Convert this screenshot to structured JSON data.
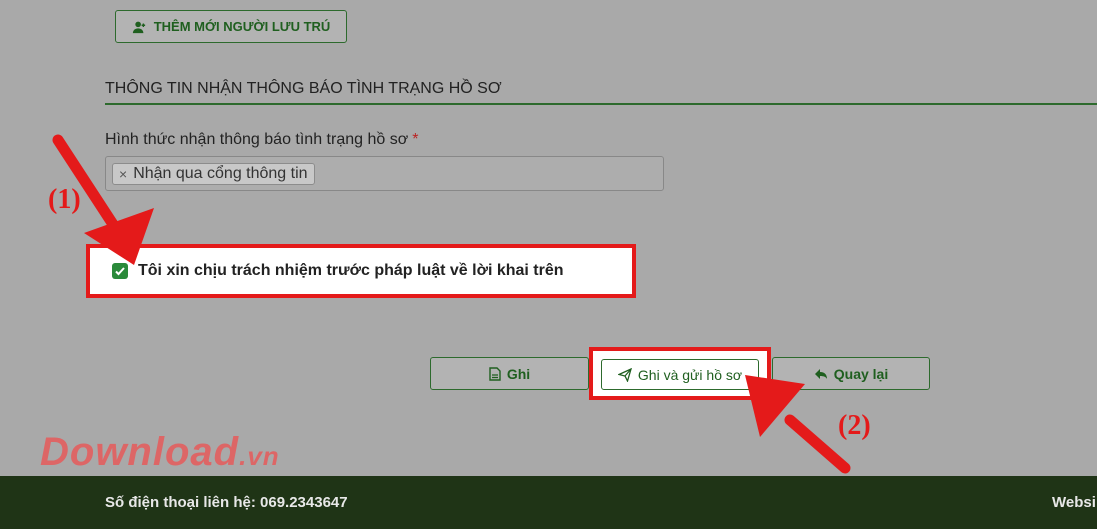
{
  "toolbar": {
    "add_resident_label": "THÊM MỚI NGƯỜI LƯU TRÚ"
  },
  "section": {
    "title": "THÔNG TIN NHẬN THÔNG BÁO TÌNH TRẠNG HỒ SƠ"
  },
  "notify_field": {
    "label": "Hình thức nhận thông báo tình trạng hồ sơ",
    "required_mark": "*",
    "selected_tag": "Nhận qua cổng thông tin",
    "remove_glyph": "×"
  },
  "consent": {
    "label": "Tôi xin chịu trách nhiệm trước pháp luật về lời khai trên",
    "checked": true
  },
  "actions": {
    "save_label": "Ghi",
    "save_send_label": "Ghi và gửi hồ sơ",
    "back_label": "Quay lại"
  },
  "annotations": {
    "step1": "(1)",
    "step2": "(2)",
    "color": "#e41a1a"
  },
  "watermark": {
    "brand": "Download",
    "tld": ".vn"
  },
  "footer": {
    "phone_label": "Số điện thoại liên hệ: 069.2343647",
    "website_label": "Websi"
  },
  "colors": {
    "accent": "#2d6a2d",
    "footer_bg": "#1f3416",
    "checkbox": "#2a8a3a"
  }
}
